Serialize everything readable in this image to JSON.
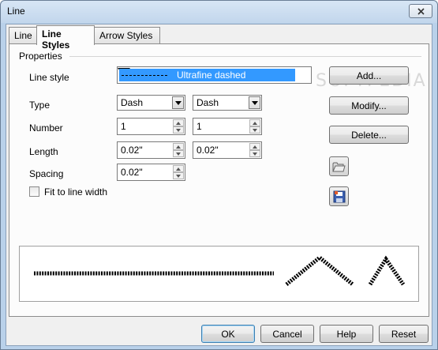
{
  "window": {
    "title": "Line"
  },
  "tabs": [
    {
      "label": "Line",
      "active": false
    },
    {
      "label": "Line Styles",
      "active": true
    },
    {
      "label": "Arrow Styles",
      "active": false
    }
  ],
  "properties": {
    "group_label": "Properties",
    "line_style": {
      "label": "Line style",
      "value": "Ultrafine dashed"
    },
    "type": {
      "label": "Type",
      "value1": "Dash",
      "value2": "Dash"
    },
    "number": {
      "label": "Number",
      "value1": "1",
      "value2": "1"
    },
    "length": {
      "label": "Length",
      "value1": "0.02\"",
      "value2": "0.02\""
    },
    "spacing": {
      "label": "Spacing",
      "value": "0.02\""
    },
    "fit_to_line_width": {
      "label": "Fit to line width",
      "checked": false
    }
  },
  "side_buttons": {
    "add": "Add...",
    "modify": "Modify...",
    "delete": "Delete..."
  },
  "footer_buttons": {
    "ok": "OK",
    "cancel": "Cancel",
    "help": "Help",
    "reset": "Reset"
  },
  "watermark": "SOFTPEDIA"
}
